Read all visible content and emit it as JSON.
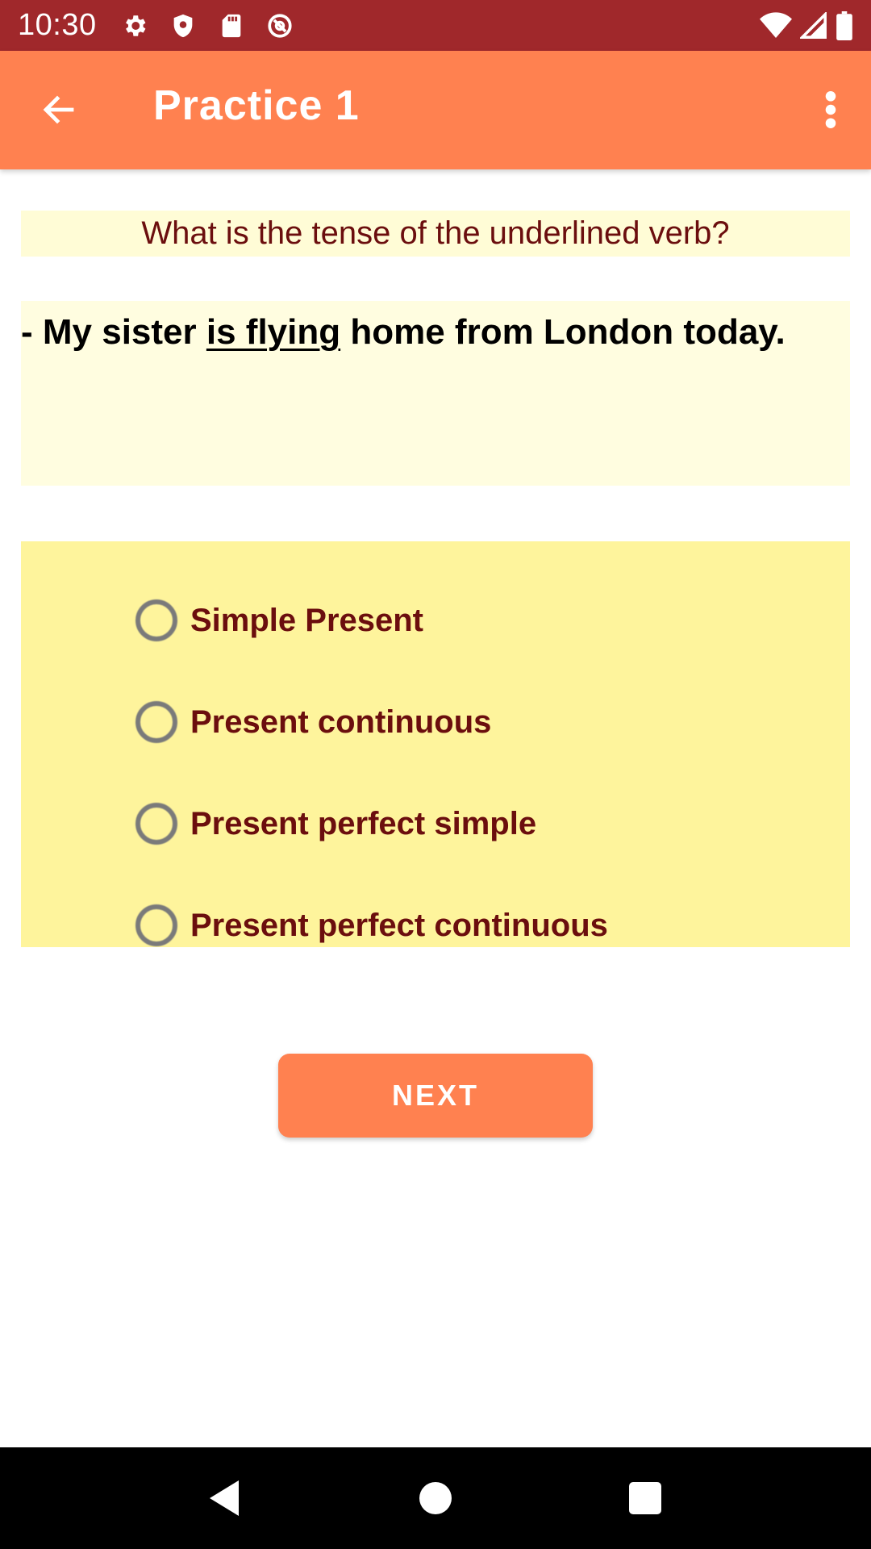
{
  "status_bar": {
    "time": "10:30",
    "left_icons": [
      "settings-icon",
      "shield-icon",
      "sd-card-icon",
      "at-sign-icon"
    ],
    "right_icons": [
      "wifi-icon",
      "cell-signal-icon",
      "battery-icon"
    ]
  },
  "app_bar": {
    "title": "Practice 1",
    "back_icon": "arrow-left-icon",
    "menu_icon": "more-vertical-icon"
  },
  "question": {
    "prompt": "What is the tense of the underlined verb?",
    "sentence_before": "- My sister ",
    "sentence_underlined": "is flying",
    "sentence_after": " home from London today."
  },
  "options": [
    {
      "label": "Simple Present",
      "selected": false
    },
    {
      "label": "Present continuous",
      "selected": false
    },
    {
      "label": "Present perfect simple",
      "selected": false
    },
    {
      "label": "Present perfect continuous",
      "selected": false
    }
  ],
  "next_button": {
    "label": "NEXT"
  },
  "nav_bar": {
    "icons": [
      "back-triangle-icon",
      "home-circle-icon",
      "recents-square-icon"
    ]
  },
  "colors": {
    "status_bar": "#a0282b",
    "app_bar": "#ff8150",
    "question_bg": "#fffcd6",
    "options_bg": "#fef49c",
    "accent_text": "#6b0e0e"
  }
}
